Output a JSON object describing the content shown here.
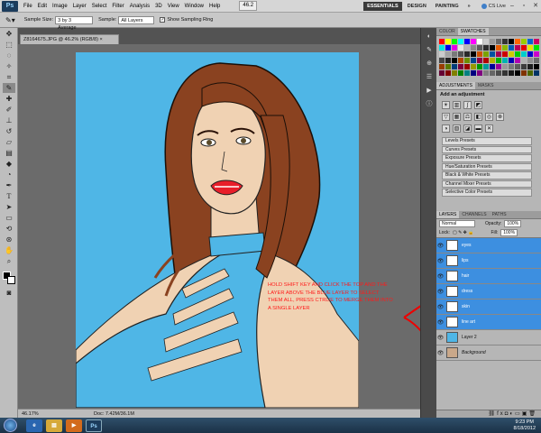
{
  "app": {
    "logo": "Ps",
    "zoom": "46.2"
  },
  "menu": [
    "File",
    "Edit",
    "Image",
    "Layer",
    "Select",
    "Filter",
    "Analysis",
    "3D",
    "View",
    "Window",
    "Help"
  ],
  "workspaces": {
    "essentials": "ESSENTIALS",
    "design": "DESIGN",
    "painting": "PAINTING",
    "more": "»",
    "cslive": "CS Live"
  },
  "options": {
    "sample_size_label": "Sample Size:",
    "sample_size": "3 by 3 Average",
    "sample_label": "Sample:",
    "sample": "All Layers",
    "ring_label": "Show Sampling Ring"
  },
  "document": {
    "tab": "Z8164675.JPG @ 46.2% (RGB/8) ×",
    "zoom": "46.17%",
    "doc_info": "Doc: 7.42M/36.1M"
  },
  "annotation": "HOLD SHIFT KEY AND CLICK THE TOP AND THE LAYER ABOVE THE BLUE LAYER TO SELECT THEM ALL, PRESS CTRL/E TO MERGE THEM INTO A SINGLE  LAYER",
  "panels": {
    "color_tab": "COLOR",
    "swatches_tab": "SWATCHES",
    "adjustments_tab": "ADJUSTMENTS",
    "masks_tab": "MASKS",
    "add_adjustment": "Add an adjustment",
    "presets": [
      "Levels Presets",
      "Curves Presets",
      "Exposure Presets",
      "Hue/Saturation Presets",
      "Black & White Presets",
      "Channel Mixer Presets",
      "Selective Color Presets"
    ],
    "layers_tab": "LAYERS",
    "channels_tab": "CHANNELS",
    "paths_tab": "PATHS",
    "blend_mode": "Normal",
    "opacity_label": "Opacity:",
    "opacity": "100%",
    "lock_label": "Lock:",
    "fill_label": "Fill:",
    "fill": "100%"
  },
  "layers": [
    {
      "name": "eyes",
      "selected": true
    },
    {
      "name": "lips",
      "selected": true
    },
    {
      "name": "hair",
      "selected": true
    },
    {
      "name": "dress",
      "selected": true
    },
    {
      "name": "skin",
      "selected": true
    },
    {
      "name": "line art",
      "selected": true
    },
    {
      "name": "Layer 2",
      "selected": false
    },
    {
      "name": "Background",
      "selected": false
    }
  ],
  "taskbar": {
    "time": "9:23 PM",
    "date": "8/18/2012",
    "ps": "Ps"
  },
  "colors": {
    "accent": "#3d8fe0",
    "canvas_bg": "#4fb6e6",
    "skin": "#f0d2b3",
    "hair": "#8a4220",
    "dress": "#4fb6e6",
    "lips": "#e81e2a",
    "annotation": "#ff1a1a"
  }
}
